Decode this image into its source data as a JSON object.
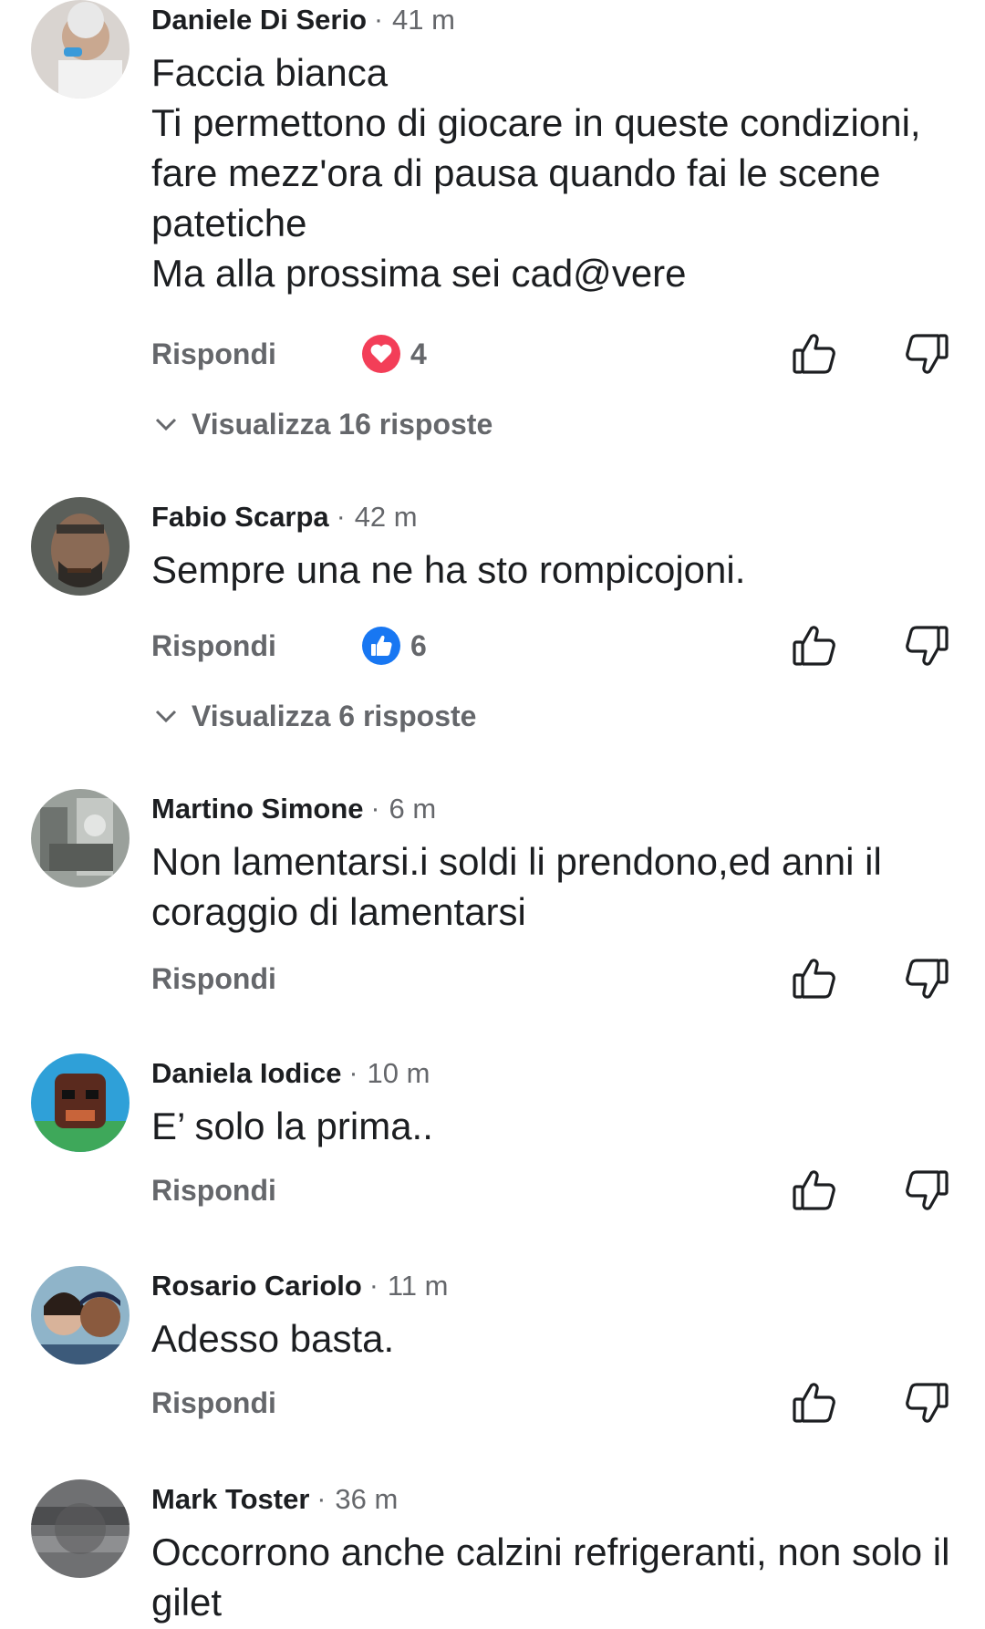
{
  "comments": [
    {
      "author": "Daniele Di Serio",
      "time": "41 m",
      "text": "Faccia bianca\nTi permettono di giocare in queste condizioni, fare mezz'ora di pausa quando fai le scene patetiche\nMa alla prossima sei cad@vere",
      "reply_label": "Rispondi",
      "reaction": {
        "icon": "heart-icon",
        "count": "4",
        "color": "#f33e58"
      },
      "view_replies": "Visualizza 16 risposte"
    },
    {
      "author": "Fabio Scarpa",
      "time": "42 m",
      "text": "Sempre una ne ha sto rompicojoni.",
      "reply_label": "Rispondi",
      "reaction": {
        "icon": "thumbs-up-icon",
        "count": "6",
        "color": "#1877f2"
      },
      "view_replies": "Visualizza 6 risposte"
    },
    {
      "author": "Martino Simone",
      "time": "6 m",
      "text": "Non lamentarsi.i soldi li prendono,ed anni il coraggio di lamentarsi",
      "reply_label": "Rispondi"
    },
    {
      "author": "Daniela Iodice",
      "time": "10 m",
      "text": "E’ solo la prima..",
      "reply_label": "Rispondi"
    },
    {
      "author": "Rosario Cariolo",
      "time": "11 m",
      "text": "Adesso basta.",
      "reply_label": "Rispondi"
    },
    {
      "author": "Mark Toster",
      "time": "36 m",
      "text": "Occorrono anche calzini refrigeranti, non solo il gilet"
    }
  ],
  "colors": {
    "text": "#1c1e21",
    "secondary": "#65676b",
    "heart": "#f33e58",
    "like": "#1877f2"
  }
}
